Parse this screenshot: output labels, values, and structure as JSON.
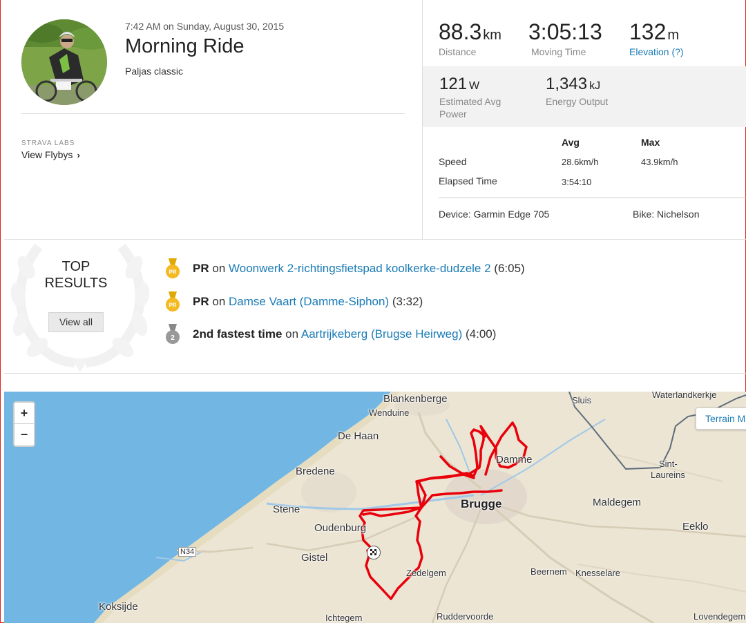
{
  "activity": {
    "datetime": "7:42 AM on Sunday, August 30, 2015",
    "title": "Morning Ride",
    "description": "Paljas classic"
  },
  "labs": {
    "label": "STRAVA LABS",
    "flybys_link": "View Flybys"
  },
  "stats": {
    "distance": {
      "value": "88.3",
      "unit": "km",
      "label": "Distance"
    },
    "moving_time": {
      "value": "3:05:13",
      "label": "Moving Time"
    },
    "elevation": {
      "value": "132",
      "unit": "m",
      "label": "Elevation (?)"
    },
    "power": {
      "value": "121",
      "unit": "W",
      "label": "Estimated Avg Power"
    },
    "energy": {
      "value": "1,343",
      "unit": "kJ",
      "label": "Energy Output"
    }
  },
  "more_stats": {
    "headers": {
      "avg": "Avg",
      "max": "Max"
    },
    "speed": {
      "label": "Speed",
      "avg": "28.6km/h",
      "max": "43.9km/h"
    },
    "elapsed": {
      "label": "Elapsed Time",
      "avg": "3:54:10"
    },
    "device": "Device: Garmin Edge 705",
    "bike": "Bike: Nichelson"
  },
  "top_results": {
    "title_line1": "TOP",
    "title_line2": "RESULTS",
    "view_all": "View all",
    "items": [
      {
        "medal": "PR",
        "medal_color": "#f5b921",
        "prefix": "PR",
        "on": "on",
        "segment": "Woonwerk 2-richtingsfietspad koolkerke-dudzele 2",
        "time": "(6:05)"
      },
      {
        "medal": "PR",
        "medal_color": "#f5b921",
        "prefix": "PR",
        "on": "on",
        "segment": "Damse Vaart (Damme-Siphon)",
        "time": "(3:32)"
      },
      {
        "medal": "2",
        "medal_color": "#999999",
        "prefix": "2nd fastest time",
        "on": "on",
        "segment": "Aartrijkeberg (Brugse Heirweg)",
        "time": "(4:00)"
      }
    ]
  },
  "map": {
    "zoom_in": "+",
    "zoom_out": "−",
    "terrain_button": "Terrain M",
    "route_color": "#e8000b",
    "labels": {
      "blankenberge": "Blankenberge",
      "wenduine": "Wenduine",
      "de_haan": "De Haan",
      "bredene": "Bredene",
      "stene": "Stene",
      "oudenburg": "Oudenburg",
      "n34": "N34",
      "gistel": "Gistel",
      "koksijde": "Koksijde",
      "ichtegem": "Ichtegem",
      "zedelgem": "Zedelgem",
      "ruddervoorde": "Ruddervoorde",
      "brugge": "Brugge",
      "damme": "Damme",
      "sluis": "Sluis",
      "waterlandkerkje": "Waterlandkerkje",
      "sint_laureins_1": "Sint-",
      "sint_laureins_2": "Laureins",
      "maldegem": "Maldegem",
      "eeklo": "Eeklo",
      "beernem": "Beernem",
      "knesselare": "Knesselare",
      "lovendegem": "Lovendegem"
    }
  }
}
